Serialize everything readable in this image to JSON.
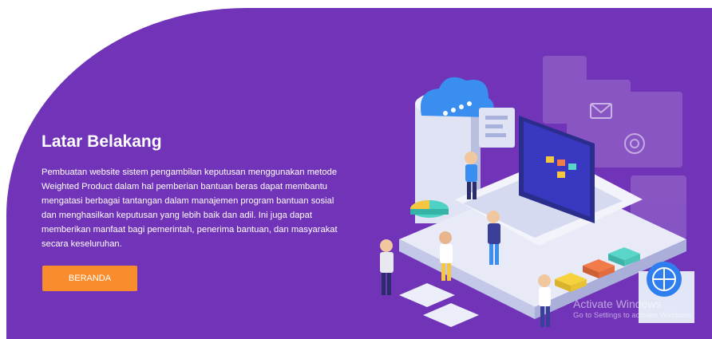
{
  "hero": {
    "title": "Latar Belakang",
    "description": "Pembuatan website sistem pengambilan keputusan menggunakan metode Weighted Product dalam hal pemberian bantuan beras dapat membantu mengatasi berbagai tantangan dalam manajemen program bantuan sosial dan menghasilkan keputusan yang lebih baik dan adil. Ini juga dapat memberikan manfaat bagi pemerintah, penerima bantuan, dan masyarakat secara keseluruhan.",
    "button_label": "BERANDA"
  },
  "watermark": {
    "title": "Activate Windows",
    "subtitle": "Go to Settings to activate Windows."
  },
  "colors": {
    "background": "#7134b8",
    "button": "#f98d2d",
    "text": "#ffffff"
  },
  "icons": [
    "cloud-icon",
    "laptop-icon",
    "globe-icon",
    "chart-icon",
    "email-icon"
  ]
}
